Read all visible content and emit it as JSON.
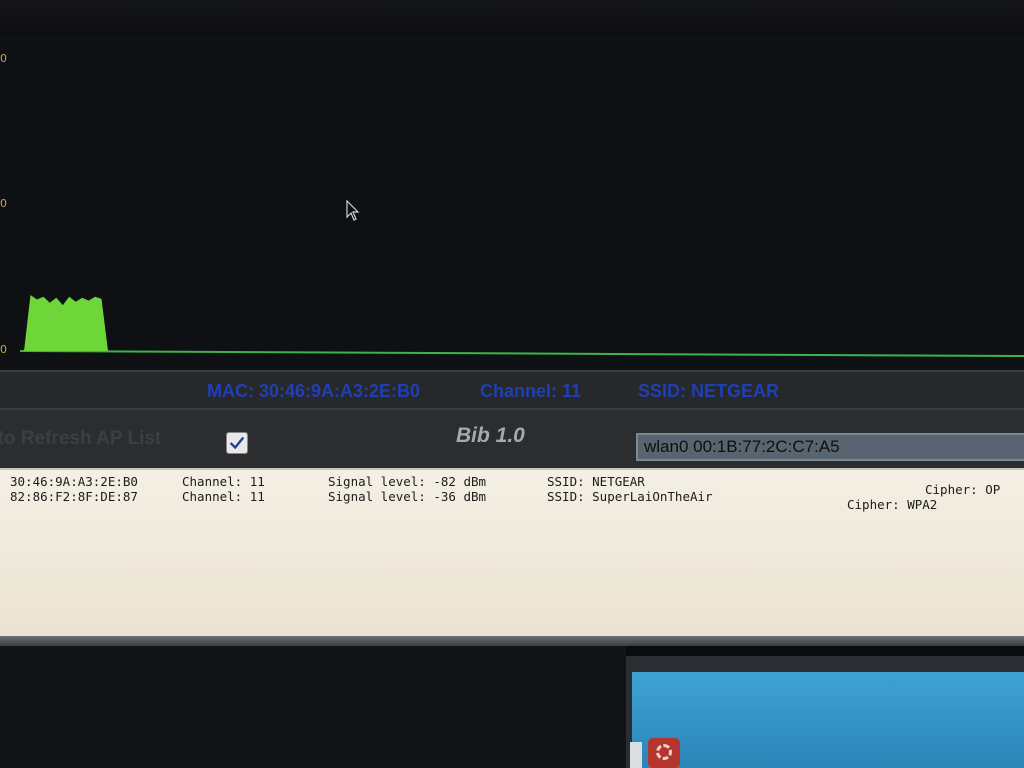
{
  "graph": {
    "y_ticks": [
      "0",
      "0",
      "0"
    ],
    "trace_color": "#6fd63a",
    "signal_trace": [
      0.0,
      1.0,
      0.92,
      0.97,
      0.86,
      0.95,
      0.82,
      0.97,
      0.88,
      0.95,
      0.9,
      0.97,
      0.93,
      0.0
    ],
    "baseline_color": "#3fb34a"
  },
  "status": {
    "mac": "MAC: 30:46:9A:A3:2E:B0",
    "channel": "Channel: 11",
    "ssid": "SSID: NETGEAR",
    "color": "#1f3fb8"
  },
  "toolbar": {
    "auto_refresh_label": "uto Refresh AP List",
    "auto_refresh_checked": true,
    "app_title": "Bib 1.0",
    "interface_value": "wlan0   00:1B:77:2C:C7:A5"
  },
  "ap_list": {
    "rows": [
      {
        "mac": "30:46:9A:A3:2E:B0",
        "channel": "Channel: 11",
        "signal": "Signal level: -82 dBm",
        "ssid": "SSID: NETGEAR",
        "cipher": "Cipher: OP"
      },
      {
        "mac": "82:86:F2:8F:DE:87",
        "channel": "Channel: 11",
        "signal": "Signal level: -36 dBm",
        "ssid": "SSID: SuperLaiOnTheAir",
        "cipher": "Cipher: WPA2"
      }
    ]
  }
}
